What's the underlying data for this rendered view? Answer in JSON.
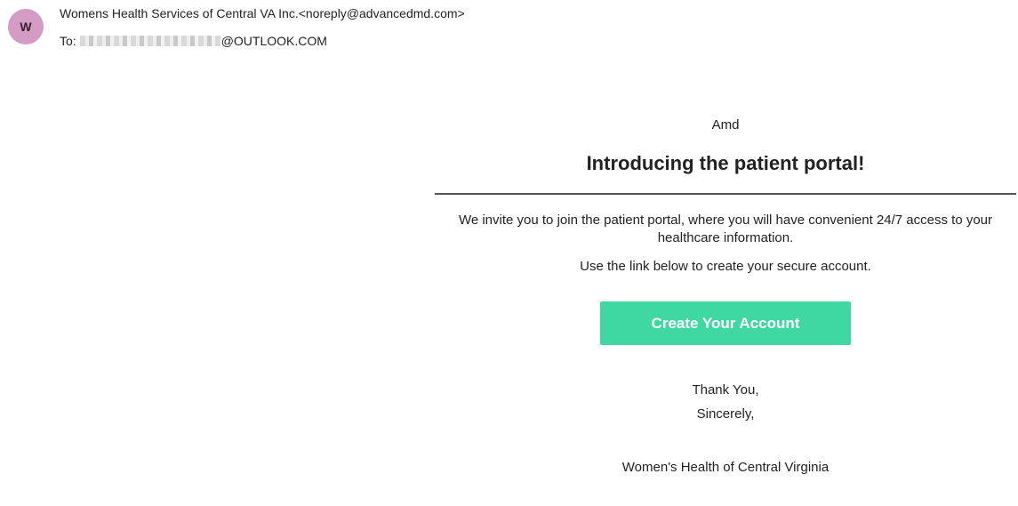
{
  "header": {
    "avatar_letter": "W",
    "sender": "Womens Health Services of Central VA Inc.<noreply@advancedmd.com>",
    "to_label": "To:",
    "to_address_suffix": "@OUTLOOK.COM"
  },
  "email": {
    "brand": "Amd",
    "title": "Introducing the patient portal!",
    "invite_text": "We invite you to join the patient portal, where you will have convenient 24/7 access to your healthcare information.",
    "instruction_text": "Use the link below to create your secure account.",
    "cta_label": "Create Your Account",
    "thanks": "Thank You,",
    "sincerely": "Sincerely,",
    "signature": "Women's Health of Central Virginia"
  },
  "colors": {
    "avatar_bg": "#d49cc5",
    "cta_bg": "#3fd8a3",
    "divider": "#555555"
  }
}
